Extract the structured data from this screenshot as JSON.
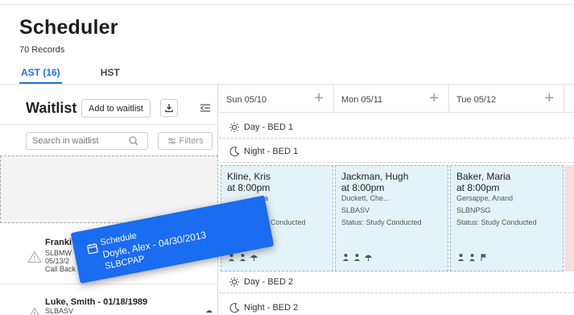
{
  "page": {
    "title": "Scheduler",
    "records": "70 Records"
  },
  "tabs": [
    {
      "label": "AST (16)",
      "active": true
    },
    {
      "label": "HST",
      "active": false
    }
  ],
  "waitlist": {
    "title": "Waitlist",
    "add_label": "Add to waitlist",
    "search_placeholder": "Search in waitlist",
    "filters_label": "Filters",
    "items": [
      {
        "name": "Franki",
        "line1": "SLBMW",
        "line2": "05/13/2",
        "line3": "Call Back"
      },
      {
        "name": "Luke, Smith - 01/18/1989",
        "line1": "SLBASV",
        "line2": "",
        "line3": ""
      }
    ]
  },
  "calendar": {
    "days": [
      {
        "label": "Sun 05/10"
      },
      {
        "label": "Mon 05/11"
      },
      {
        "label": "Tue 05/12"
      }
    ],
    "shifts": {
      "day1": "Day - BED 1",
      "night1": "Night - BED 1",
      "day2": "Day - BED 2",
      "night2": "Night - BED 2"
    },
    "appointments": [
      {
        "name": "Kline, Kris",
        "time": "at 8:00pm",
        "doctor": "da",
        "code": "",
        "status": "y Conducted"
      },
      {
        "name": "Jackman, Hugh",
        "time": "at 8:00pm",
        "doctor": "Duckett, Che...",
        "code": "SLBASV",
        "status": "Status: Study Conducted"
      },
      {
        "name": "Baker, Maria",
        "time": "at 8:00pm",
        "doctor": "Gersappe, Anand",
        "code": "SLBNPSG",
        "status": "Status: Study Conducted"
      }
    ]
  },
  "drag_card": {
    "label": "Schedule",
    "patient": "Doyle, Alex - 04/30/2013",
    "code": "SLBCPAP"
  },
  "colors": {
    "accent": "#1a73e8",
    "card": "#1a6cf0",
    "cell_bg": "#e4f3f8",
    "alert_edge": "#f7dede"
  }
}
